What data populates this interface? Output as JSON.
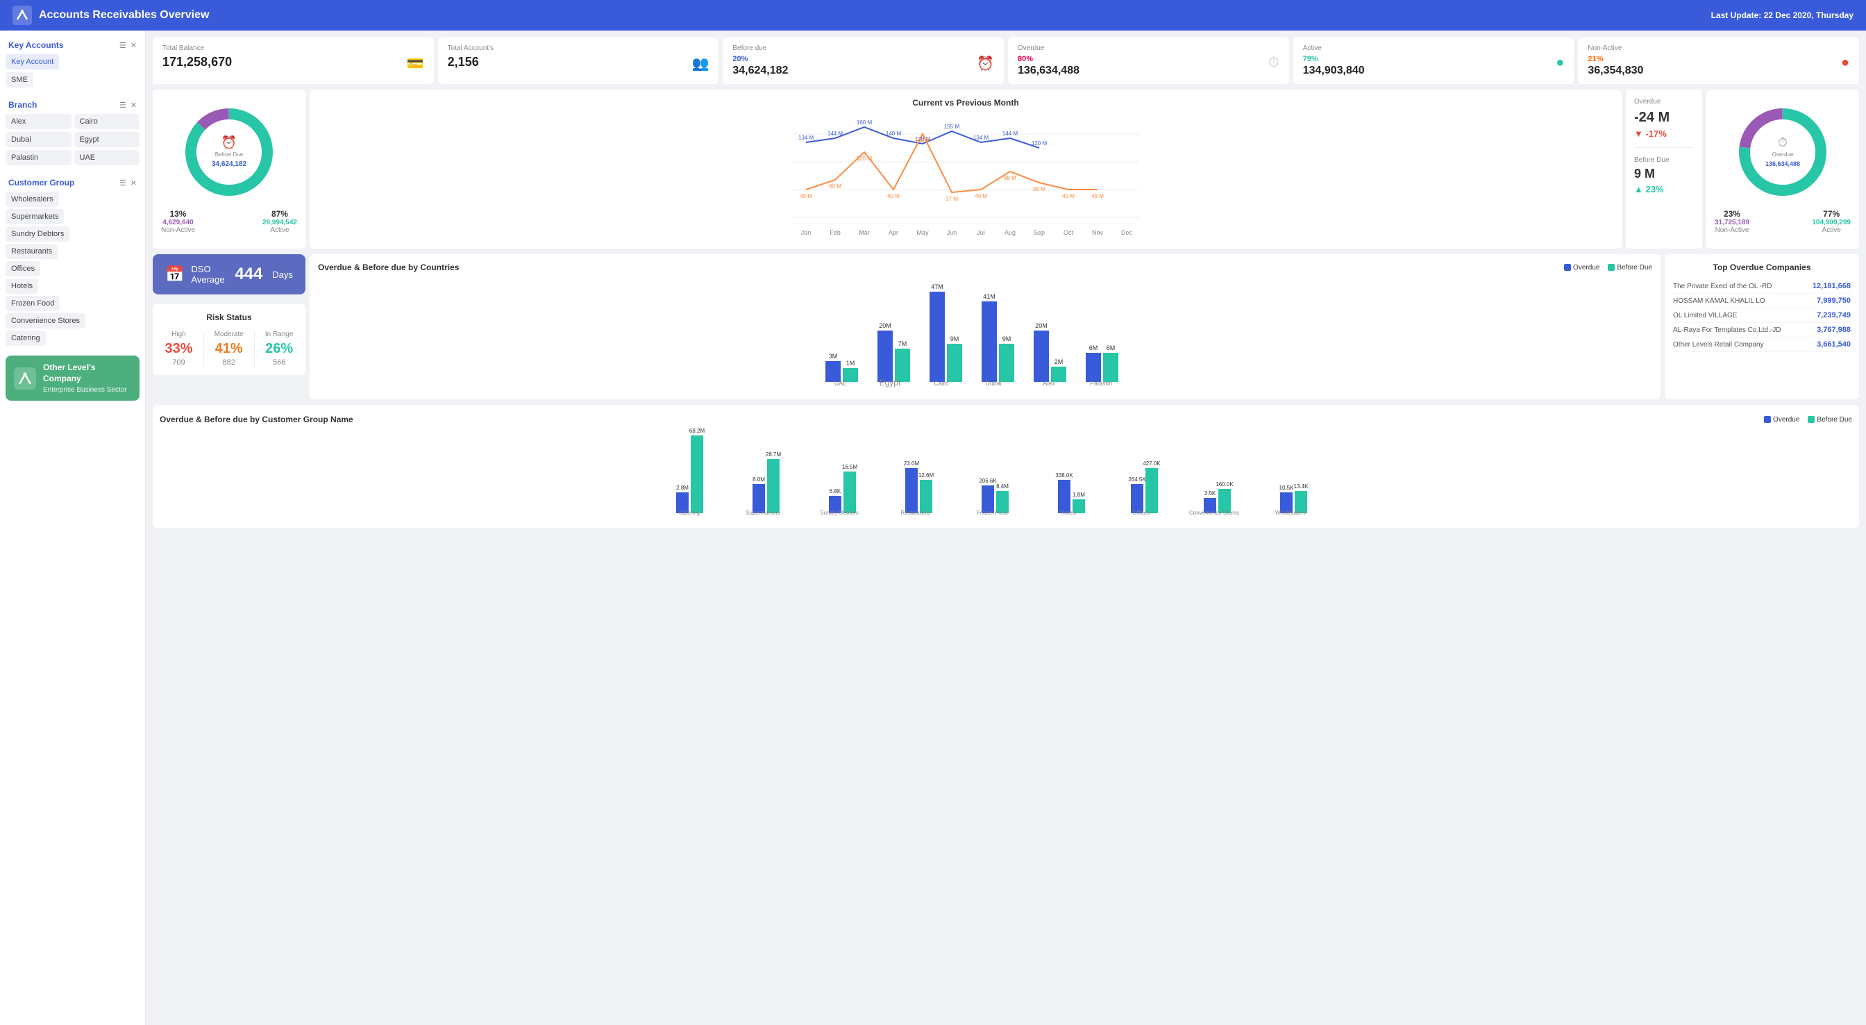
{
  "header": {
    "title": "Accounts Receivables Overview",
    "last_update_label": "Last Update:",
    "last_update_value": "22 Dec 2020, Thursday"
  },
  "stats": [
    {
      "id": "total-balance",
      "label": "Total Balance",
      "value": "171,258,670",
      "icon": "💳"
    },
    {
      "id": "total-accounts",
      "label": "Total Account's",
      "value": "2,156",
      "icon": "👥"
    },
    {
      "id": "before-due",
      "label": "Before due",
      "pct": "20%",
      "pct_color": "blue",
      "value": "34,624,182",
      "icon": "⏰"
    },
    {
      "id": "overdue",
      "label": "Overdue",
      "pct": "80%",
      "pct_color": "red",
      "value": "136,634,488",
      "icon": "⏱"
    },
    {
      "id": "active",
      "label": "Active",
      "pct": "79%",
      "pct_color": "teal",
      "value": "134,903,840",
      "dot_color": "#26c6a6"
    },
    {
      "id": "non-active",
      "label": "Non-Active",
      "pct": "21%",
      "pct_color": "orange",
      "value": "36,354,830",
      "dot_color": "#e74c3c"
    }
  ],
  "before_due_donut": {
    "title": "Before Due",
    "value": "34,624,182",
    "left_pct": "13%",
    "left_value": "4,629,640",
    "left_label": "Non-Active",
    "right_pct": "87%",
    "right_value": "29,994,542",
    "right_label": "Active"
  },
  "overdue_donut": {
    "title": "Overdue",
    "value": "136,634,488",
    "left_pct": "23%",
    "left_value": "31,725,189",
    "left_label": "Non-Active",
    "right_pct": "77%",
    "right_value": "104,909,299",
    "right_label": "Active"
  },
  "overdue_change": {
    "label": "Overdue",
    "value": "-24 M",
    "pct_label": "▼ -17%",
    "pct_color": "red"
  },
  "before_due_change": {
    "label": "Before Due",
    "value": "9 M",
    "pct_label": "▲ 23%",
    "pct_color": "teal"
  },
  "line_chart": {
    "title": "Current vs Previous Month",
    "months": [
      "Jan",
      "Feb",
      "Mar",
      "Apr",
      "May",
      "Jun",
      "Jul",
      "Aug",
      "Sep",
      "Oct",
      "Nov",
      "Dec"
    ],
    "series1": [
      49,
      60,
      120,
      40,
      140,
      37,
      40,
      88,
      55,
      40,
      49,
      0
    ],
    "series2": [
      134,
      144,
      160,
      140,
      130,
      155,
      134,
      144,
      120,
      0,
      0,
      0
    ],
    "labels1": [
      "49 M",
      "60 M",
      "120 M",
      "40 M",
      "140 M",
      "37 M",
      "40 M",
      "88 M",
      "55 M",
      "40 M",
      "49 M"
    ],
    "labels2": [
      "134 M",
      "144 M",
      "160 M",
      "140 M",
      "130 M",
      "155 M",
      "134 M",
      "144 M",
      "120 M"
    ]
  },
  "dso": {
    "label": "DSO Average",
    "value": "444",
    "unit": "Days"
  },
  "risk": {
    "title": "Risk Status",
    "high_label": "High",
    "high_pct": "33%",
    "high_count": "709",
    "moderate_label": "Moderate",
    "moderate_pct": "41%",
    "moderate_count": "882",
    "in_range_label": "In Range",
    "in_range_pct": "26%",
    "in_range_count": "566"
  },
  "overdue_by_country": {
    "title": "Overdue & Before due by Countries",
    "legend_overdue": "Overdue",
    "legend_before_due": "Before Due",
    "countries": [
      "UAE",
      "Egypt",
      "Cairo",
      "Dubai",
      "Alex",
      "Palastin"
    ],
    "overdue_vals": [
      3,
      20,
      47,
      41,
      20,
      6
    ],
    "before_due_vals": [
      1,
      7,
      9,
      9,
      2,
      6
    ],
    "overdue_labels": [
      "3M",
      "20M",
      "47M",
      "41M",
      "20M",
      "6M"
    ],
    "before_due_labels": [
      "1M",
      "7M",
      "9M",
      "9M",
      "2M",
      "6M"
    ]
  },
  "top_companies": {
    "title": "Top Overdue Companies",
    "items": [
      {
        "name": "The Private Execl of the OL -RD",
        "value": "12,181,668"
      },
      {
        "name": "HOSSAM KAMAL KHALIL LO",
        "value": "7,999,750"
      },
      {
        "name": "OL Limited VILLAGE",
        "value": "7,239,749"
      },
      {
        "name": "AL-Raya For Templates Co.Ltd.-JD",
        "value": "3,767,988"
      },
      {
        "name": "Other Levels Retail Company",
        "value": "3,661,540"
      }
    ]
  },
  "overdue_by_group": {
    "title": "Overdue & Before due by Customer Group Name",
    "legend_overdue": "Overdue",
    "legend_before_due": "Before Due",
    "groups": [
      "Catering",
      "Supermarkets",
      "Sundry Debtors",
      "Restaurants",
      "Frozen Food",
      "Hotels",
      "Offices",
      "Convenience Stores",
      "Wholesalers"
    ],
    "overdue_vals": [
      2.8,
      8.0,
      6.8,
      23.0,
      206.6,
      338.0,
      264.5,
      3.5,
      10.5
    ],
    "before_due_vals": [
      68.2,
      28.7,
      16.5,
      12.6,
      8.4,
      1.8,
      427.0,
      160.0,
      13.4
    ],
    "overdue_labels": [
      "2.8M",
      "8.0M",
      "6.8K",
      "23.0M",
      "206.6K",
      "338.0K",
      "264.5K",
      "3.5K",
      "10.5K"
    ],
    "before_due_labels": [
      "68.2M",
      "28.7M",
      "16.5M",
      "12.6M",
      "8.4M",
      "1.8M",
      "427.0K",
      "160.0K",
      "13.4K"
    ]
  },
  "sidebar": {
    "key_accounts_label": "Key Accounts",
    "key_account_btn": "Key Account",
    "sme_btn": "SME",
    "branch_label": "Branch",
    "branches": [
      "Alex",
      "Cairo",
      "Dubai",
      "Egypt",
      "Palastin",
      "UAE"
    ],
    "customer_group_label": "Customer Group",
    "customer_groups": [
      "Wholesalers",
      "Supermarkets",
      "Sundry Debtors",
      "Restaurants",
      "Offices",
      "Hotels",
      "Frozen Food",
      "Convenience Stores",
      "Catering"
    ],
    "company_name": "Other Level's Company",
    "company_sector": "Enterprise Business Sector"
  }
}
